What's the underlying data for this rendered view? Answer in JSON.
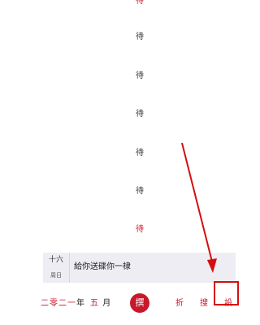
{
  "calendar_column": {
    "chars": [
      {
        "text": "待",
        "color": "red"
      },
      {
        "text": "待",
        "color": "dark"
      },
      {
        "text": "待",
        "color": "dark"
      },
      {
        "text": "待",
        "color": "dark"
      },
      {
        "text": "待",
        "color": "dark"
      },
      {
        "text": "待",
        "color": "dark"
      },
      {
        "text": "待",
        "color": "red"
      }
    ]
  },
  "entry": {
    "day": "十六",
    "weekday": "周日",
    "text": "給你送碟你一棣"
  },
  "bottom_bar": {
    "year": "二零二一",
    "year_unit": "年",
    "month": "五",
    "month_unit": "月",
    "write_label": "撰",
    "fold_label": "折",
    "search_label": "搜",
    "settings_label": "設"
  },
  "colors": {
    "accent": "#c8182b",
    "annotation": "#d40f0f",
    "entry_bg": "#ededf3"
  },
  "annotation": {
    "type": "arrow-and-box",
    "target": "settings-button"
  }
}
